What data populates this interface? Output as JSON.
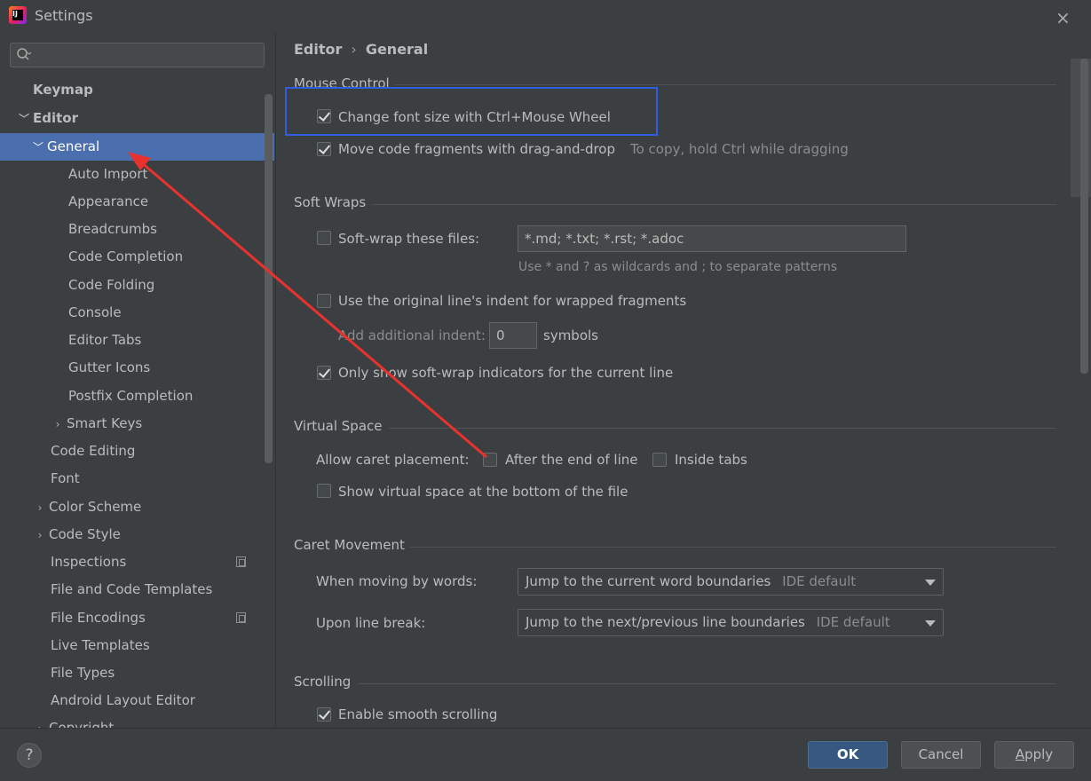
{
  "window": {
    "title": "Settings",
    "close_icon": "×"
  },
  "search": {
    "placeholder": "",
    "value": ""
  },
  "sidebar": {
    "items": [
      {
        "label": "Keymap"
      },
      {
        "label": "Editor"
      },
      {
        "label": "General"
      },
      {
        "label": "Auto Import"
      },
      {
        "label": "Appearance"
      },
      {
        "label": "Breadcrumbs"
      },
      {
        "label": "Code Completion"
      },
      {
        "label": "Code Folding"
      },
      {
        "label": "Console"
      },
      {
        "label": "Editor Tabs"
      },
      {
        "label": "Gutter Icons"
      },
      {
        "label": "Postfix Completion"
      },
      {
        "label": "Smart Keys"
      },
      {
        "label": "Code Editing"
      },
      {
        "label": "Font"
      },
      {
        "label": "Color Scheme"
      },
      {
        "label": "Code Style"
      },
      {
        "label": "Inspections"
      },
      {
        "label": "File and Code Templates"
      },
      {
        "label": "File Encodings"
      },
      {
        "label": "Live Templates"
      },
      {
        "label": "File Types"
      },
      {
        "label": "Android Layout Editor"
      },
      {
        "label": "Copyright"
      }
    ],
    "selected": "General"
  },
  "breadcrumb": {
    "parent": "Editor",
    "separator": "›",
    "current": "General"
  },
  "mouse_control": {
    "title": "Mouse Control",
    "change_font_size": {
      "label": "Change font size with Ctrl+Mouse Wheel",
      "checked": true
    },
    "move_code": {
      "label": "Move code fragments with drag-and-drop",
      "checked": true,
      "hint": "To copy, hold Ctrl while dragging"
    }
  },
  "soft_wraps": {
    "title": "Soft Wraps",
    "soft_wrap_files": {
      "label": "Soft-wrap these files:",
      "checked": false,
      "value": "*.md; *.txt; *.rst; *.adoc",
      "hint": "Use * and ? as wildcards and ; to separate patterns"
    },
    "original_indent": {
      "label": "Use the original line's indent for wrapped fragments",
      "checked": false
    },
    "additional_indent": {
      "label": "Add additional indent:",
      "value": "0",
      "unit": "symbols"
    },
    "only_current_line": {
      "label": "Only show soft-wrap indicators for the current line",
      "checked": true
    }
  },
  "virtual_space": {
    "title": "Virtual Space",
    "caret_label": "Allow caret placement:",
    "after_end": {
      "label": "After the end of line",
      "checked": false
    },
    "inside_tabs": {
      "label": "Inside tabs",
      "checked": false
    },
    "show_bottom": {
      "label": "Show virtual space at the bottom of the file",
      "checked": false
    }
  },
  "caret_movement": {
    "title": "Caret Movement",
    "words": {
      "label": "When moving by words:",
      "value": "Jump to the current word boundaries",
      "note": "IDE default"
    },
    "line_break": {
      "label": "Upon line break:",
      "value": "Jump to the next/previous line boundaries",
      "note": "IDE default"
    }
  },
  "scrolling": {
    "title": "Scrolling",
    "smooth": {
      "label": "Enable smooth scrolling",
      "checked": true
    }
  },
  "footer": {
    "help": "?",
    "ok": "OK",
    "cancel": "Cancel",
    "apply_a": "A",
    "apply_rest": "pply"
  },
  "colors": {
    "selection": "#4b6eaf",
    "highlight_box": "#2f5ee0",
    "arrow": "#e8322e",
    "primary_button": "#365880"
  }
}
